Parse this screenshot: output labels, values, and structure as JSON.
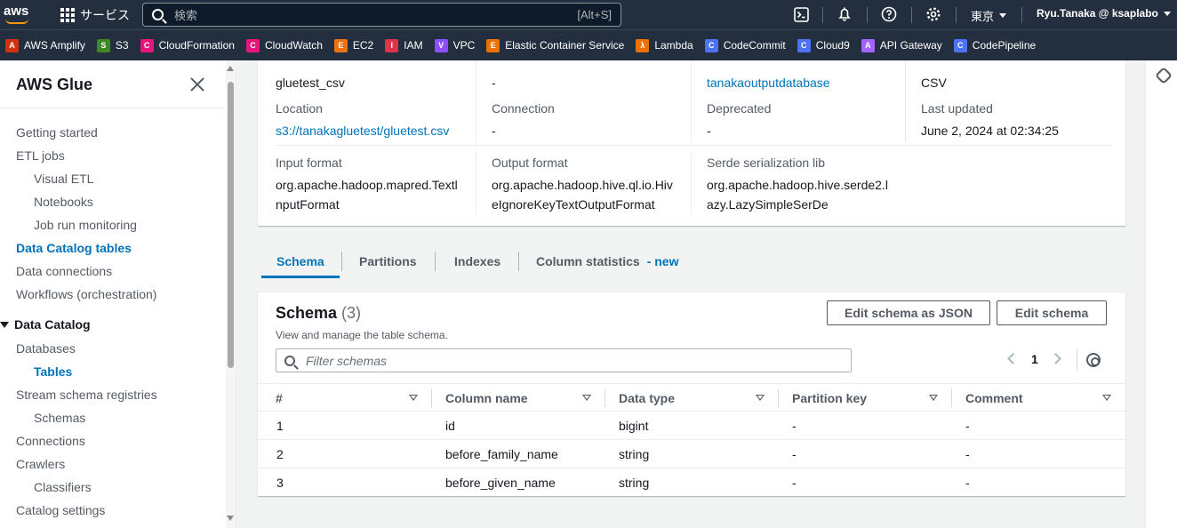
{
  "topnav": {
    "logo_text": "aws",
    "services_label": "サービス",
    "search_placeholder": "検索",
    "search_shortcut": "[Alt+S]",
    "region": "東京",
    "user": "Ryu.Tanaka @ ksaplabo"
  },
  "favorites": [
    {
      "label": "AWS Amplify",
      "icon": "amplify-icon",
      "color": "#d13212",
      "glyph": "A"
    },
    {
      "label": "S3",
      "icon": "s3-icon",
      "color": "#3f8624",
      "glyph": "S"
    },
    {
      "label": "CloudFormation",
      "icon": "cloudformation-icon",
      "color": "#e7157b",
      "glyph": "C"
    },
    {
      "label": "CloudWatch",
      "icon": "cloudwatch-icon",
      "color": "#e7157b",
      "glyph": "C"
    },
    {
      "label": "EC2",
      "icon": "ec2-icon",
      "color": "#ec7211",
      "glyph": "E"
    },
    {
      "label": "IAM",
      "icon": "iam-icon",
      "color": "#dd344c",
      "glyph": "I"
    },
    {
      "label": "VPC",
      "icon": "vpc-icon",
      "color": "#8c4fff",
      "glyph": "V"
    },
    {
      "label": "Elastic Container Service",
      "icon": "ecs-icon",
      "color": "#ed7100",
      "glyph": "E"
    },
    {
      "label": "Lambda",
      "icon": "lambda-icon",
      "color": "#ed7100",
      "glyph": "λ"
    },
    {
      "label": "CodeCommit",
      "icon": "codecommit-icon",
      "color": "#4d72f3",
      "glyph": "C"
    },
    {
      "label": "Cloud9",
      "icon": "cloud9-icon",
      "color": "#4d72f3",
      "glyph": "C"
    },
    {
      "label": "API Gateway",
      "icon": "apigateway-icon",
      "color": "#a166ff",
      "glyph": "A"
    },
    {
      "label": "CodePipeline",
      "icon": "codepipeline-icon",
      "color": "#4d72f3",
      "glyph": "C"
    }
  ],
  "sidebar": {
    "title": "AWS Glue",
    "items": [
      {
        "label": "Getting started"
      },
      {
        "label": "ETL jobs"
      },
      {
        "label": "Visual ETL"
      },
      {
        "label": "Notebooks"
      },
      {
        "label": "Job run monitoring"
      },
      {
        "label": "Data Catalog tables"
      },
      {
        "label": "Data connections"
      },
      {
        "label": "Workflows (orchestration)"
      },
      {
        "label": "Data Catalog"
      },
      {
        "label": "Databases"
      },
      {
        "label": "Tables"
      },
      {
        "label": "Stream schema registries"
      },
      {
        "label": "Schemas"
      },
      {
        "label": "Connections"
      },
      {
        "label": "Crawlers"
      },
      {
        "label": "Classifiers"
      },
      {
        "label": "Catalog settings"
      }
    ]
  },
  "details": {
    "row0": {
      "name": "gluetest_csv",
      "description": "-",
      "database": "tanakaoutputdatabase",
      "classification": "CSV"
    },
    "location_label": "Location",
    "location_value": "s3://tanakagluetest/gluetest.csv",
    "connection_label": "Connection",
    "connection_value": "-",
    "deprecated_label": "Deprecated",
    "deprecated_value": "-",
    "last_updated_label": "Last updated",
    "last_updated_value": "June 2, 2024 at 02:34:25",
    "input_format_label": "Input format",
    "input_format_line1": "org.apache.hadoop.mapred.Textl",
    "input_format_line2": "nputFormat",
    "output_format_label": "Output format",
    "output_format_line1": "org.apache.hadoop.hive.ql.io.Hiv",
    "output_format_line2": "eIgnoreKeyTextOutputFormat",
    "serde_label": "Serde serialization lib",
    "serde_line1": "org.apache.hadoop.hive.serde2.l",
    "serde_line2": "azy.LazySimpleSerDe"
  },
  "tabs": [
    {
      "label": "Schema",
      "active": true
    },
    {
      "label": "Partitions"
    },
    {
      "label": "Indexes"
    },
    {
      "label": "Column statistics",
      "badge": "- new"
    }
  ],
  "schema": {
    "title": "Schema",
    "count": "(3)",
    "description": "View and manage the table schema.",
    "edit_json_label": "Edit schema as JSON",
    "edit_label": "Edit schema",
    "filter_placeholder": "Filter schemas",
    "page": "1",
    "columns": [
      "#",
      "Column name",
      "Data type",
      "Partition key",
      "Comment"
    ],
    "rows": [
      [
        "1",
        "id",
        "bigint",
        "-",
        "-"
      ],
      [
        "2",
        "before_family_name",
        "string",
        "-",
        "-"
      ],
      [
        "3",
        "before_given_name",
        "string",
        "-",
        "-"
      ]
    ]
  }
}
